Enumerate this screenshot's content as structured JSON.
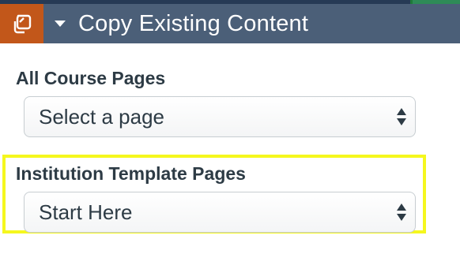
{
  "header": {
    "title": "Copy Existing Content",
    "icon": "copy-icon",
    "toggle_icon": "caret-down-icon",
    "icon_bg_color": "#c2571a",
    "bar_color": "#4b5f78"
  },
  "course_pages": {
    "label": "All Course Pages",
    "selected": "Select a page"
  },
  "template_pages": {
    "label": "Institution Template Pages",
    "selected": "Start Here",
    "highlight_color": "#f5f71e"
  }
}
